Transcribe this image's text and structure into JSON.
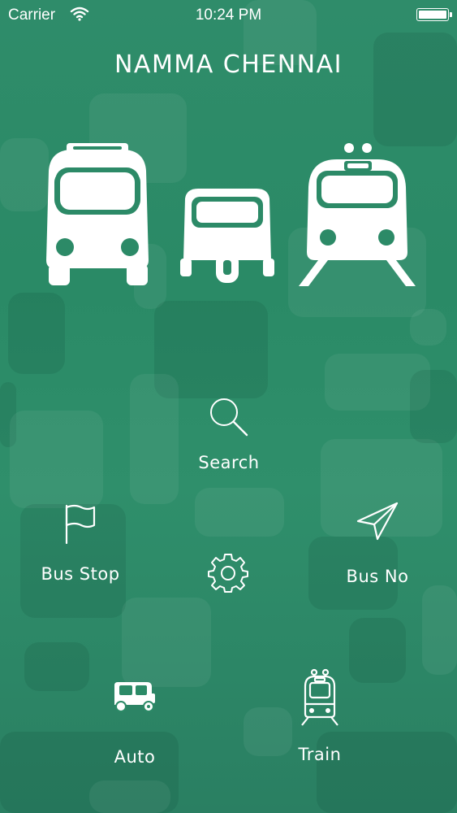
{
  "status_bar": {
    "carrier": "Carrier",
    "time": "10:24 PM",
    "wifi_icon": "wifi-icon",
    "battery_icon": "battery-icon",
    "battery_level": 1.0
  },
  "app": {
    "title": "NAMMA CHENNAI"
  },
  "hero": {
    "icons": [
      "bus-icon",
      "auto-rickshaw-icon",
      "train-icon"
    ]
  },
  "menu": {
    "search": {
      "label": "Search",
      "icon": "search-icon"
    },
    "bus_stop": {
      "label": "Bus Stop",
      "icon": "flag-icon"
    },
    "settings": {
      "icon": "gear-icon"
    },
    "bus_no": {
      "label": "Bus No",
      "icon": "paper-plane-icon"
    },
    "auto": {
      "label": "Auto",
      "icon": "auto-rickshaw-icon"
    },
    "train": {
      "label": "Train",
      "icon": "train-icon"
    }
  },
  "colors": {
    "background": "#2c8a67",
    "foreground": "#ffffff"
  }
}
